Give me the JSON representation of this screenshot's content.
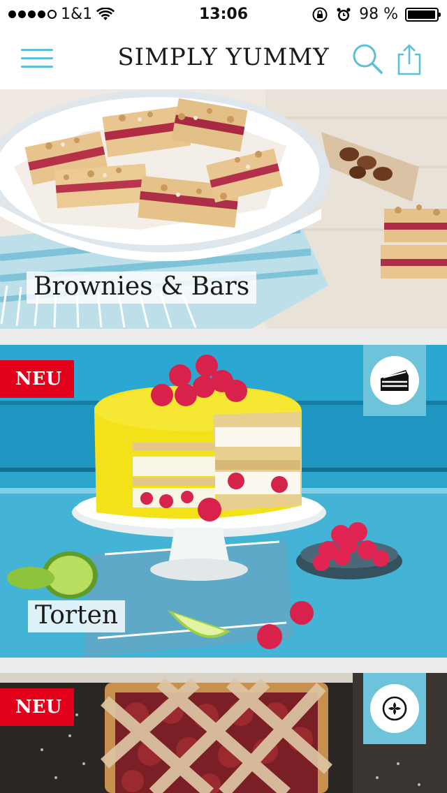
{
  "status_bar": {
    "carrier": "1&1",
    "time": "13:06",
    "battery": "98 %",
    "battery_level": 0.98,
    "signal_bars_filled": 4,
    "signal_bars_total": 5
  },
  "nav": {
    "title": "SIMPLY YUMMY",
    "menu_icon": "hamburger-menu-icon",
    "search_icon": "search-icon",
    "share_icon": "share-icon",
    "accent_color": "#5bbfd6"
  },
  "cards": [
    {
      "category": "Brownies & Bars",
      "badge": "",
      "type_icon": ""
    },
    {
      "category": "Torten",
      "badge": "NEU",
      "type_icon": "cake-slice-icon"
    },
    {
      "category": "",
      "badge": "NEU",
      "type_icon": "pie-icon"
    }
  ],
  "colors": {
    "badge_red": "#e3001b",
    "type_badge_blue": "#6cc3da"
  }
}
